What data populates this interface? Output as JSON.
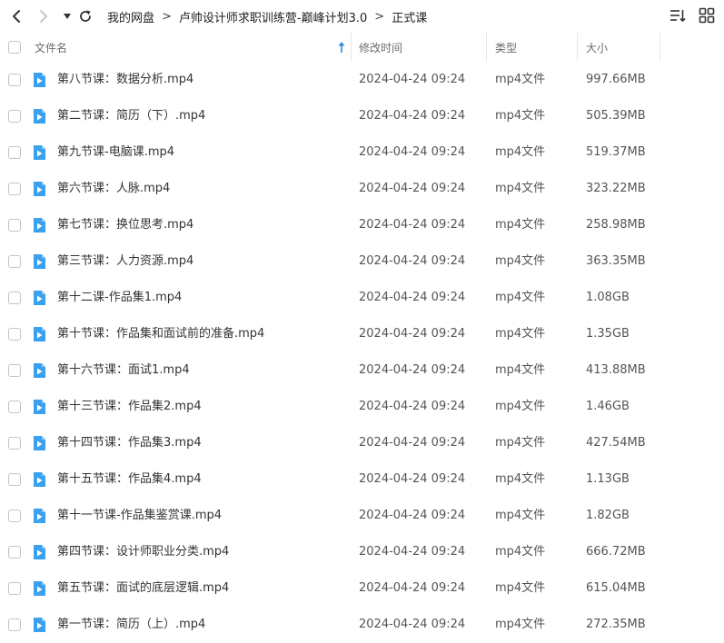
{
  "breadcrumb": [
    "我的网盘",
    "卢帅设计师求职训练营-巅峰计划3.0",
    "正式课"
  ],
  "breadcrumb_separator": ">",
  "columns": {
    "name": "文件名",
    "modified": "修改时间",
    "type": "类型",
    "size": "大小"
  },
  "icons": {
    "back": "back-arrow-icon",
    "forward": "forward-arrow-icon",
    "history": "dropdown-triangle-icon",
    "refresh": "refresh-icon",
    "sort_list": "sort-list-icon",
    "grid_view": "grid-view-icon",
    "file": "video-file-icon",
    "sort_asc": "sort-up-arrow-icon"
  },
  "colors": {
    "file_icon": "#3aa0f0",
    "sort_arrow": "#2a8be0"
  },
  "files": [
    {
      "name": "第八节课：数据分析.mp4",
      "modified": "2024-04-24 09:24",
      "type": "mp4文件",
      "size": "997.66MB"
    },
    {
      "name": "第二节课：简历（下）.mp4",
      "modified": "2024-04-24 09:24",
      "type": "mp4文件",
      "size": "505.39MB"
    },
    {
      "name": "第九节课-电脑课.mp4",
      "modified": "2024-04-24 09:24",
      "type": "mp4文件",
      "size": "519.37MB"
    },
    {
      "name": "第六节课：人脉.mp4",
      "modified": "2024-04-24 09:24",
      "type": "mp4文件",
      "size": "323.22MB"
    },
    {
      "name": "第七节课：换位思考.mp4",
      "modified": "2024-04-24 09:24",
      "type": "mp4文件",
      "size": "258.98MB"
    },
    {
      "name": "第三节课：人力资源.mp4",
      "modified": "2024-04-24 09:24",
      "type": "mp4文件",
      "size": "363.35MB"
    },
    {
      "name": "第十二课-作品集1.mp4",
      "modified": "2024-04-24 09:24",
      "type": "mp4文件",
      "size": "1.08GB"
    },
    {
      "name": "第十节课：作品集和面试前的准备.mp4",
      "modified": "2024-04-24 09:24",
      "type": "mp4文件",
      "size": "1.35GB"
    },
    {
      "name": "第十六节课：面试1.mp4",
      "modified": "2024-04-24 09:24",
      "type": "mp4文件",
      "size": "413.88MB"
    },
    {
      "name": "第十三节课：作品集2.mp4",
      "modified": "2024-04-24 09:24",
      "type": "mp4文件",
      "size": "1.46GB"
    },
    {
      "name": "第十四节课：作品集3.mp4",
      "modified": "2024-04-24 09:24",
      "type": "mp4文件",
      "size": "427.54MB"
    },
    {
      "name": "第十五节课：作品集4.mp4",
      "modified": "2024-04-24 09:24",
      "type": "mp4文件",
      "size": "1.13GB"
    },
    {
      "name": "第十一节课-作品集鉴赏课.mp4",
      "modified": "2024-04-24 09:24",
      "type": "mp4文件",
      "size": "1.82GB"
    },
    {
      "name": "第四节课：设计师职业分类.mp4",
      "modified": "2024-04-24 09:24",
      "type": "mp4文件",
      "size": "666.72MB"
    },
    {
      "name": "第五节课：面试的底层逻辑.mp4",
      "modified": "2024-04-24 09:24",
      "type": "mp4文件",
      "size": "615.04MB"
    },
    {
      "name": "第一节课：简历（上）.mp4",
      "modified": "2024-04-24 09:24",
      "type": "mp4文件",
      "size": "272.35MB"
    }
  ]
}
